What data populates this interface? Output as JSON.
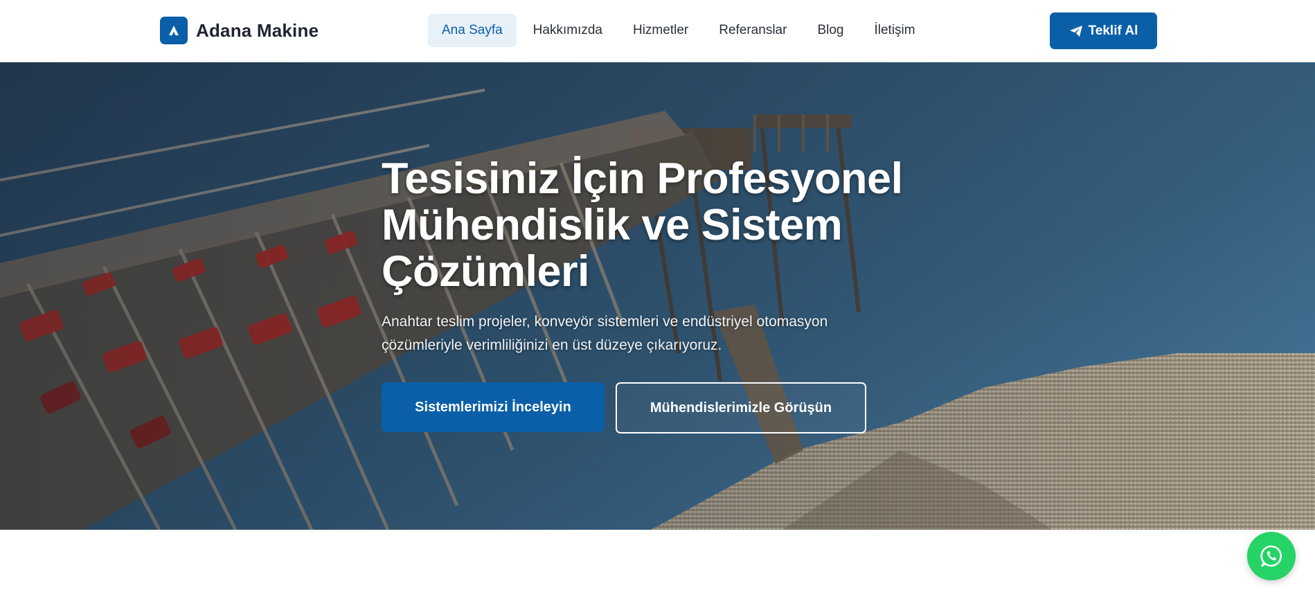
{
  "header": {
    "brand_name": "Adana Makine",
    "nav": [
      {
        "label": "Ana Sayfa",
        "active": true
      },
      {
        "label": "Hakkımızda",
        "active": false
      },
      {
        "label": "Hizmetler",
        "active": false
      },
      {
        "label": "Referanslar",
        "active": false
      },
      {
        "label": "Blog",
        "active": false
      },
      {
        "label": "İletişim",
        "active": false
      }
    ],
    "cta_label": "Teklif Al",
    "cta_icon": "paper-plane-icon"
  },
  "hero": {
    "title": "Tesisiniz İçin Profesyonel Mühendislik ve Sistem Çözümleri",
    "subtitle": "Anahtar teslim projeler, konveyör sistemleri ve endüstriyel otomasyon çözümleriyle verimliliğinizi en üst düzeye çıkarıyoruz.",
    "primary_button": "Sistemlerimizi İnceleyin",
    "secondary_button": "Mühendislerimizle Görüşün"
  },
  "floating": {
    "whatsapp_icon": "whatsapp-icon"
  },
  "colors": {
    "brand": "#0a5fa8",
    "active_nav_bg": "#e8f0f8",
    "whatsapp": "#25d366"
  }
}
